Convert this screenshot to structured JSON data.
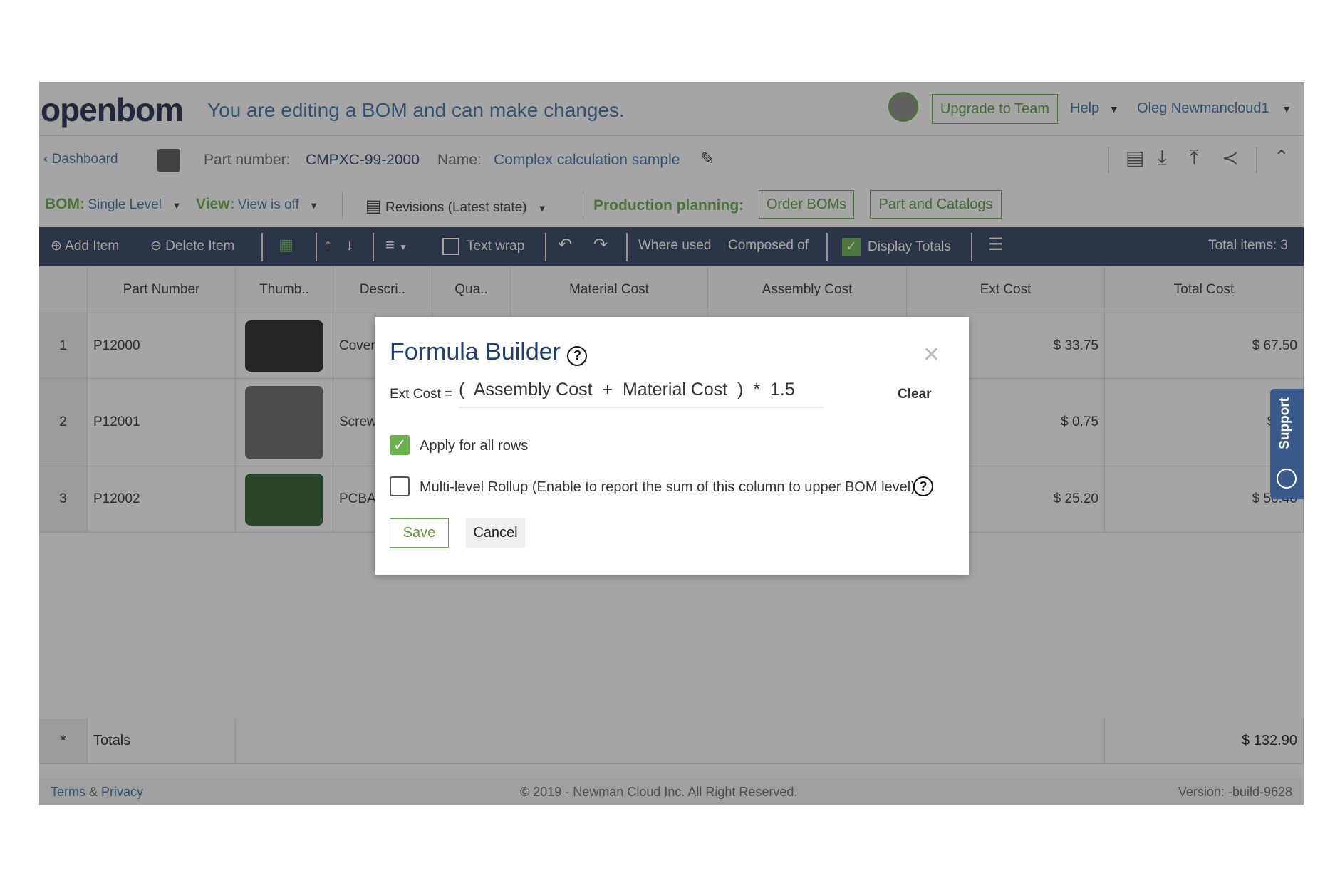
{
  "header": {
    "logo": "openbom",
    "message": "You are editing a BOM and can make changes.",
    "upgrade": "Upgrade to Team",
    "help": "Help",
    "user": "Oleg Newmancloud1"
  },
  "partbar": {
    "dashboard": "Dashboard",
    "part_number_label": "Part number:",
    "part_number": "CMPXC-99-2000",
    "name_label": "Name:",
    "name": "Complex calculation sample"
  },
  "bombar": {
    "bom_label": "BOM:",
    "bom_value": "Single Level",
    "view_label": "View:",
    "view_value": "View is off",
    "revisions": "Revisions (Latest state)",
    "production_label": "Production planning:",
    "order_boms": "Order BOMs",
    "part_catalogs": "Part and Catalogs"
  },
  "toolbar": {
    "add": "Add Item",
    "delete": "Delete Item",
    "text_wrap": "Text wrap",
    "where_used": "Where used",
    "composed_of": "Composed of",
    "display_totals": "Display Totals",
    "display_totals_checked": true,
    "total_items": "Total items: 3"
  },
  "table": {
    "columns": [
      "Part Number",
      "Thumb..",
      "Descri..",
      "Qua..",
      "Material Cost",
      "Assembly Cost",
      "Ext Cost",
      "Total Cost"
    ],
    "rows": [
      {
        "idx": "1",
        "part": "P12000",
        "desc": "Cover",
        "ext": "$ 33.75",
        "total": "$ 67.50"
      },
      {
        "idx": "2",
        "part": "P12001",
        "desc": "Screw",
        "ext": "$ 0.75",
        "total": "$ 1..."
      },
      {
        "idx": "3",
        "part": "P12002",
        "desc": "PCBA",
        "ext": "$ 25.20",
        "total": "$ 50.40"
      }
    ],
    "totals_marker": "*",
    "totals_label": "Totals",
    "totals_value": "$ 132.90"
  },
  "footer": {
    "terms": "Terms",
    "amp": "&",
    "privacy": "Privacy",
    "copyright": "© 2019 - Newman Cloud Inc. All Right Reserved.",
    "version": "Version: -build-9628"
  },
  "support": "Support",
  "modal": {
    "title": "Formula Builder",
    "formula_label": "Ext Cost =",
    "formula_open": "(",
    "term1": "Assembly Cost",
    "op1": "+",
    "term2": "Material Cost",
    "formula_close": ")",
    "op2": "*",
    "factor": "1.5",
    "clear": "Clear",
    "apply_all": "Apply for all rows",
    "apply_all_checked": true,
    "rollup": "Multi-level Rollup (Enable to report the sum of this column to upper BOM level)",
    "rollup_checked": false,
    "save": "Save",
    "cancel": "Cancel"
  }
}
